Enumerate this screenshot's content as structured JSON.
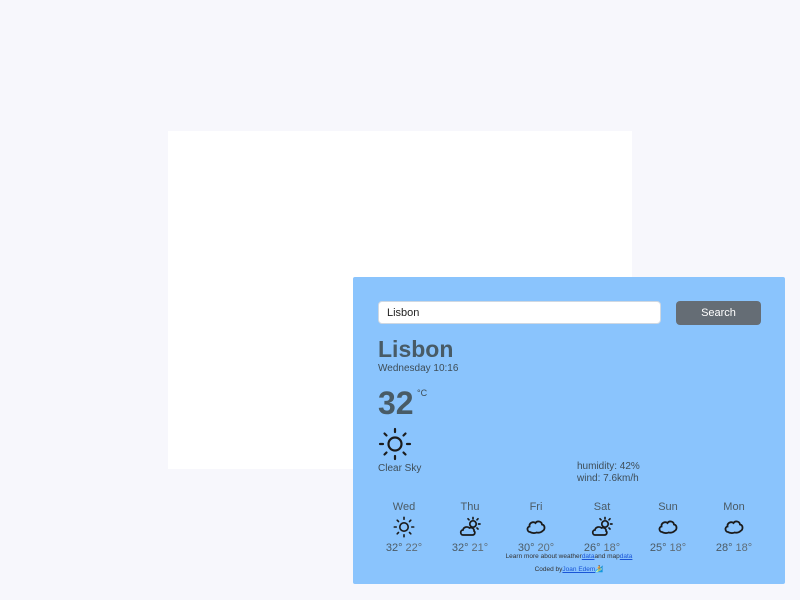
{
  "search": {
    "value": "Lisbon",
    "button": "Search"
  },
  "current": {
    "city": "Lisbon",
    "datetime": "Wednesday 10:16",
    "temperature": "32",
    "unit": "°C",
    "icon": "sun-icon",
    "description": "Clear Sky",
    "humidity": "humidity: 42%",
    "wind": "wind: 7.6km/h"
  },
  "forecast": [
    {
      "day": "Wed",
      "icon": "sun-icon",
      "high": "32°",
      "low": "22°"
    },
    {
      "day": "Thu",
      "icon": "partly-cloudy-icon",
      "high": "32°",
      "low": "21°"
    },
    {
      "day": "Fri",
      "icon": "cloud-icon",
      "high": "30°",
      "low": "20°"
    },
    {
      "day": "Sat",
      "icon": "partly-cloudy-icon",
      "high": "26°",
      "low": "18°"
    },
    {
      "day": "Sun",
      "icon": "cloud-icon",
      "high": "25°",
      "low": "18°"
    },
    {
      "day": "Mon",
      "icon": "cloud-icon",
      "high": "28°",
      "low": "18°"
    }
  ],
  "footer": {
    "learn_text": "Learn more about weather",
    "link1": "data",
    "and_text": "and map",
    "link2": "data",
    "coded_text": "Coded by",
    "author": "Joan Edem",
    "emoji": "🏄"
  },
  "colors": {
    "panel": "#8ac4fd",
    "button": "#656d75",
    "text": "#485b66"
  }
}
